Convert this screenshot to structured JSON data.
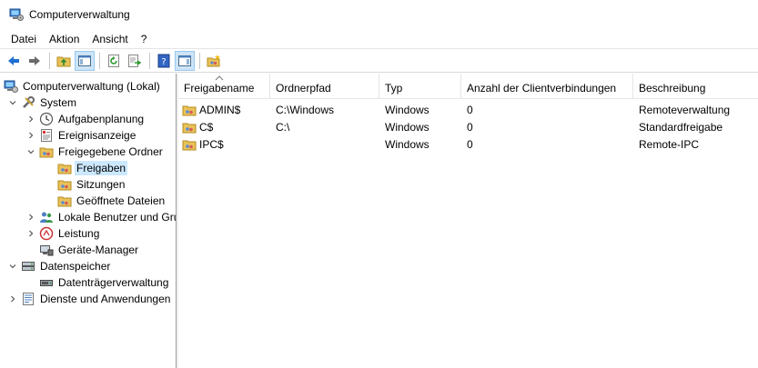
{
  "window": {
    "title": "Computerverwaltung"
  },
  "menu": {
    "items": [
      "Datei",
      "Aktion",
      "Ansicht",
      "?"
    ]
  },
  "toolbar": {
    "buttons": [
      "back-arrow-icon",
      "forward-arrow-icon",
      "up-folder-icon",
      "show-hide-tree-icon",
      "refresh-icon",
      "export-list-icon",
      "help-icon",
      "show-hide-action-pane-icon",
      "new-share-icon"
    ]
  },
  "tree": {
    "root": "Computerverwaltung (Lokal)",
    "system": "System",
    "aufgabenplanung": "Aufgabenplanung",
    "ereignisanzeige": "Ereignisanzeige",
    "freigegebene_ordner": "Freigegebene Ordner",
    "freigaben": "Freigaben",
    "sitzungen": "Sitzungen",
    "geoeffnete_dateien": "Geöffnete Dateien",
    "lokale_benutzer": "Lokale Benutzer und Gruppen",
    "leistung": "Leistung",
    "geraete_manager": "Geräte-Manager",
    "datenspeicher": "Datenspeicher",
    "datentraegerverwaltung": "Datenträgerverwaltung",
    "dienste": "Dienste und Anwendungen"
  },
  "list": {
    "columns": [
      "Freigabename",
      "Ordnerpfad",
      "Typ",
      "Anzahl der Clientverbindungen",
      "Beschreibung"
    ],
    "rows": [
      {
        "name": "ADMIN$",
        "path": "C:\\Windows",
        "type": "Windows",
        "clients": "0",
        "description": "Remoteverwaltung"
      },
      {
        "name": "C$",
        "path": "C:\\",
        "type": "Windows",
        "clients": "0",
        "description": "Standardfreigabe"
      },
      {
        "name": "IPC$",
        "path": "",
        "type": "Windows",
        "clients": "0",
        "description": "Remote-IPC"
      }
    ]
  },
  "colors": {
    "selection": "#cce8ff",
    "toolbar_active": "#cce4f7",
    "arrow_blue": "#1f6fd1"
  }
}
